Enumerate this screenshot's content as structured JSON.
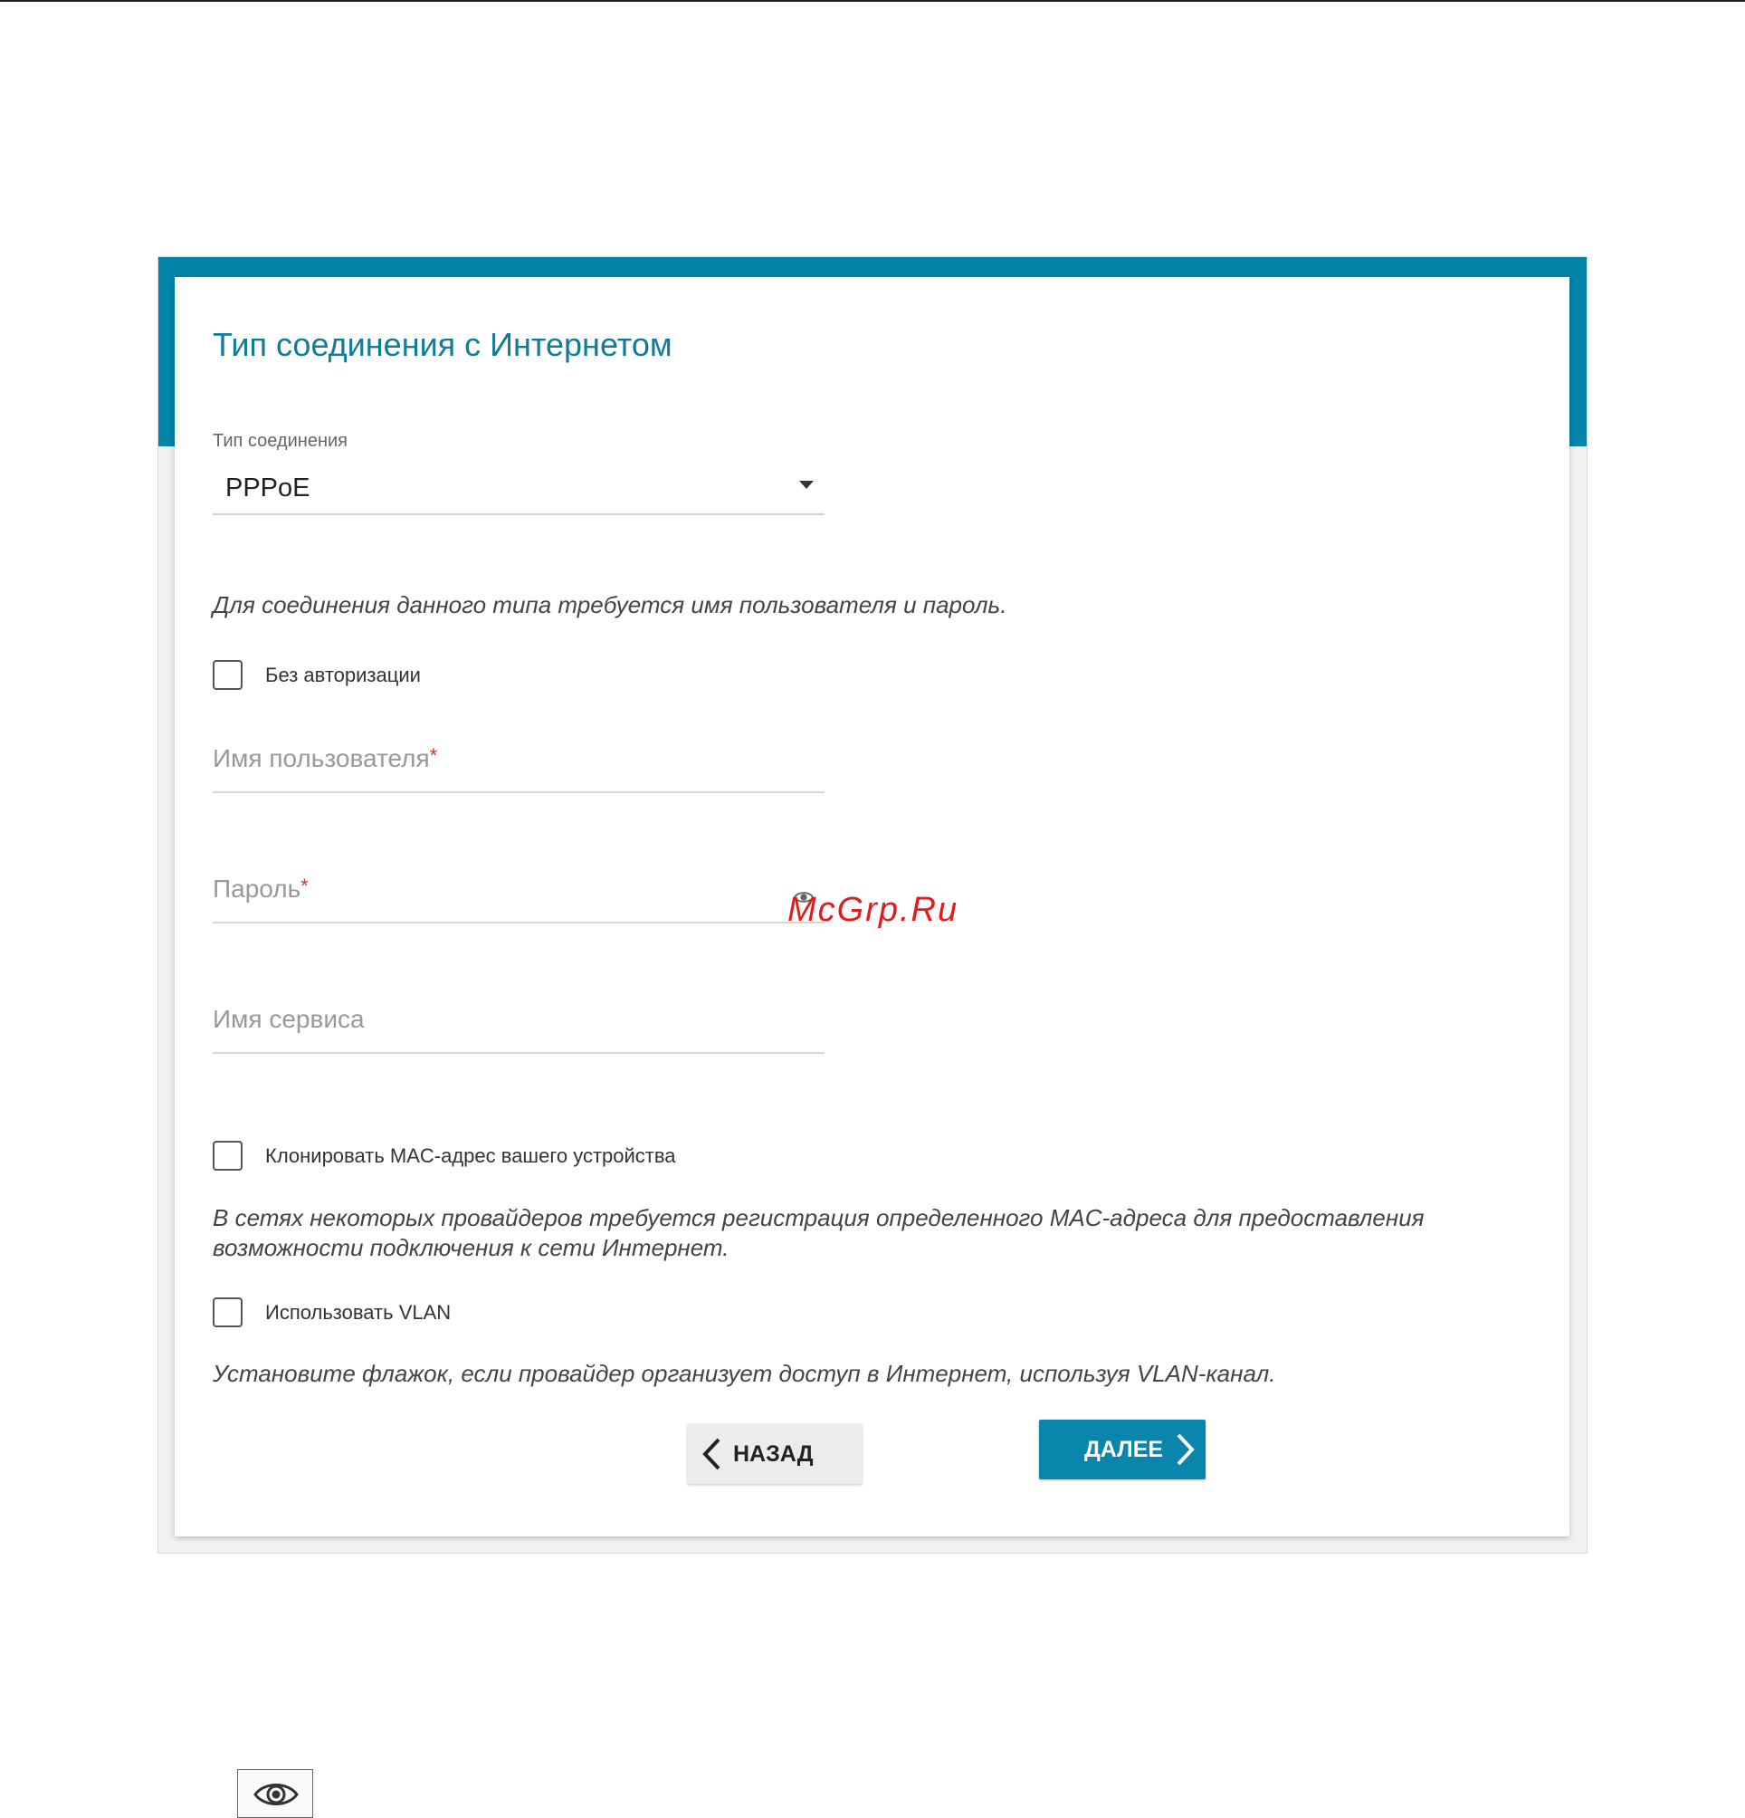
{
  "card": {
    "title": "Тип соединения с Интернетом"
  },
  "connection_type": {
    "label": "Тип соединения",
    "value": "PPPoE"
  },
  "auth_hint": "Для соединения данного типа требуется имя пользователя и пароль.",
  "no_auth": {
    "label": "Без авторизации",
    "checked": false
  },
  "username": {
    "placeholder": "Имя пользователя",
    "required_mark": "*",
    "value": ""
  },
  "password": {
    "placeholder": "Пароль",
    "required_mark": "*",
    "value": ""
  },
  "service_name": {
    "placeholder": "Имя сервиса",
    "value": ""
  },
  "clone_mac": {
    "label": "Клонировать MAC-адрес вашего устройства",
    "checked": false,
    "hint": "В сетях некоторых провайдеров требуется регистрация определенного MAC-адреса для предоставления возможности подключения к сети Интернет."
  },
  "use_vlan": {
    "label": "Использовать VLAN",
    "checked": false,
    "hint": "Установите флажок, если провайдер организует доступ в Интернет, используя VLAN-канал."
  },
  "buttons": {
    "back": "НАЗАД",
    "next": "ДАЛЕЕ"
  },
  "watermark": "McGrp.Ru",
  "colors": {
    "accent": "#0384a8",
    "title": "#137a9a",
    "required": "#d5302a",
    "watermark": "#e31b1b"
  },
  "icons": {
    "dropdown": "caret-down-icon",
    "password_visibility": "eye-icon",
    "back": "chevron-left-icon",
    "next": "chevron-right-icon"
  }
}
